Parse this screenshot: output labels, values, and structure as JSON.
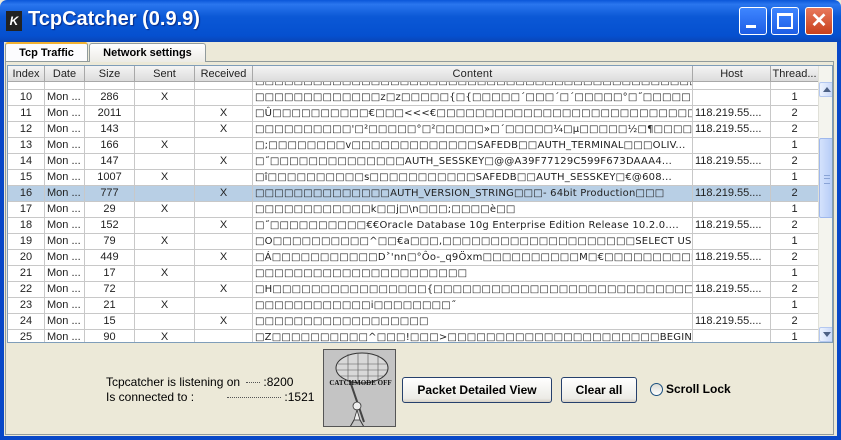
{
  "window": {
    "title": "TcpCatcher (0.9.9)"
  },
  "tabs": [
    {
      "label": "Tcp Traffic"
    },
    {
      "label": "Network settings"
    }
  ],
  "table": {
    "columns": [
      "Index",
      "Date",
      "Size",
      "Sent",
      "Received",
      "Content",
      "Host",
      "Thread..."
    ],
    "partial_row": {
      "content": "□□□□□□□□□□□□□□□□□□□□□□□□□□□□□□□□□□□□□□□□□□□□□□□□□□□□□□□□□□□□□□□□□□□□□"
    },
    "rows": [
      {
        "index": "10",
        "date": "Mon ...",
        "size": "286",
        "sent": "X",
        "received": "",
        "content": "□□□□□□□□□□□□□z□z□□□□□{□{□□□□□´□□□´□´□□□□□°□˝□□□□□´□□...",
        "host": "",
        "thread": "1"
      },
      {
        "index": "11",
        "date": "Mon ...",
        "size": "2011",
        "sent": "",
        "received": "X",
        "content": "□Û□□□□□□□□□□€□□□<<<€□□□□□□□□□□□□□□□□□□□□□□□□□□□□□□□□□□...",
        "host": "118.219.55....",
        "thread": "2"
      },
      {
        "index": "12",
        "date": "Mon ...",
        "size": "143",
        "sent": "",
        "received": "X",
        "content": "□□□□□□□□□□'□²□□□□□°□²□□□□□»□´□□□□□¼□µ□□□□□½□¶□□□□□...",
        "host": "118.219.55....",
        "thread": "2"
      },
      {
        "index": "13",
        "date": "Mon ...",
        "size": "166",
        "sent": "X",
        "received": "",
        "content": "□;□□□□□□□□v□□□□□□□□□□□□□SAFEDB□□AUTH_TERMINAL□□□OLIV...",
        "host": "",
        "thread": "1"
      },
      {
        "index": "14",
        "date": "Mon ...",
        "size": "147",
        "sent": "",
        "received": "X",
        "content": "□˝□□□□□□□□□□□□□□AUTH_SESSKEY□@@A39F77129C599F673DAAA4...",
        "host": "118.219.55....",
        "thread": "2"
      },
      {
        "index": "15",
        "date": "Mon ...",
        "size": "1007",
        "sent": "X",
        "received": "",
        "content": "□î□□□□□□□□□□s□□□□□□□□□□□SAFEDB□□AUTH_SESSKEY□€@608...",
        "host": "",
        "thread": "1"
      },
      {
        "index": "16",
        "date": "Mon ...",
        "size": "777",
        "sent": "",
        "received": "X",
        "content": "□□□□□□□□□□□□□□AUTH_VERSION_STRING□□□- 64bit Production□□□",
        "host": "118.219.55....",
        "thread": "2",
        "selected": true
      },
      {
        "index": "17",
        "date": "Mon ...",
        "size": "29",
        "sent": "X",
        "received": "",
        "content": "□□□□□□□□□□□□k□□j□\\n□□□;□□□□è□□",
        "host": "",
        "thread": "1"
      },
      {
        "index": "18",
        "date": "Mon ...",
        "size": "152",
        "sent": "",
        "received": "X",
        "content": "□˝□□□□□□□□□□€€Oracle Database 10g Enterprise Edition Release 10.2.0....",
        "host": "118.219.55....",
        "thread": "2"
      },
      {
        "index": "19",
        "date": "Mon ...",
        "size": "79",
        "sent": "X",
        "received": "",
        "content": "□O□□□□□□□□□□^□□€a□□□,□□□□□□□□□□□□□□□□□□□□SELECT US...",
        "host": "",
        "thread": "1"
      },
      {
        "index": "20",
        "date": "Mon ...",
        "size": "449",
        "sent": "",
        "received": "X",
        "content": "□Á□□□□□□□□□□□D˃'nn□°Ôo-_q9Öxm□□□□□□□□□□M□€□□□□□□□□□□□□□□...",
        "host": "118.219.55....",
        "thread": "2"
      },
      {
        "index": "21",
        "date": "Mon ...",
        "size": "17",
        "sent": "X",
        "received": "",
        "content": "□□□□□□□□□□□□□□□□□□□□□□",
        "host": "",
        "thread": "1"
      },
      {
        "index": "22",
        "date": "Mon ...",
        "size": "72",
        "sent": "",
        "received": "X",
        "content": "□H□□□□□□□□□□□□□□□□{□□□□□□□□□□□□□□□□□□□□□□□□□□□□□□□□□O...",
        "host": "118.219.55....",
        "thread": "2"
      },
      {
        "index": "23",
        "date": "Mon ...",
        "size": "21",
        "sent": "X",
        "received": "",
        "content": "□□□□□□□□□□□□i□□□□□□□□˝",
        "host": "",
        "thread": "1"
      },
      {
        "index": "24",
        "date": "Mon ...",
        "size": "15",
        "sent": "",
        "received": "X",
        "content": "□□□□□□□□□□□□□□□□□□",
        "host": "118.219.55....",
        "thread": "2"
      },
      {
        "index": "25",
        "date": "Mon ...",
        "size": "90",
        "sent": "X",
        "received": "",
        "content": "□Z□□□□□□□□□□^□□□!□□□>□□□□□□□□□□□□□□□□□□□□□□BEGIN DBMS...",
        "host": "",
        "thread": "1"
      }
    ]
  },
  "status": {
    "listening_prefix": "Tcpcatcher is listening on",
    "listening_port": ":8200",
    "connected_prefix": "Is connected to :",
    "connected_port": ":1521"
  },
  "catchmode_image": {
    "label": "CATCHMODE OFF"
  },
  "buttons": {
    "detail_label": "Packet Detailed View",
    "clear_label": "Clear all"
  },
  "scroll_lock": {
    "label": "Scroll Lock",
    "checked": false
  },
  "colors": {
    "titlebar": "#0a56d8",
    "selected_row": "#b8cfe5",
    "panel": "#ece9d8"
  }
}
